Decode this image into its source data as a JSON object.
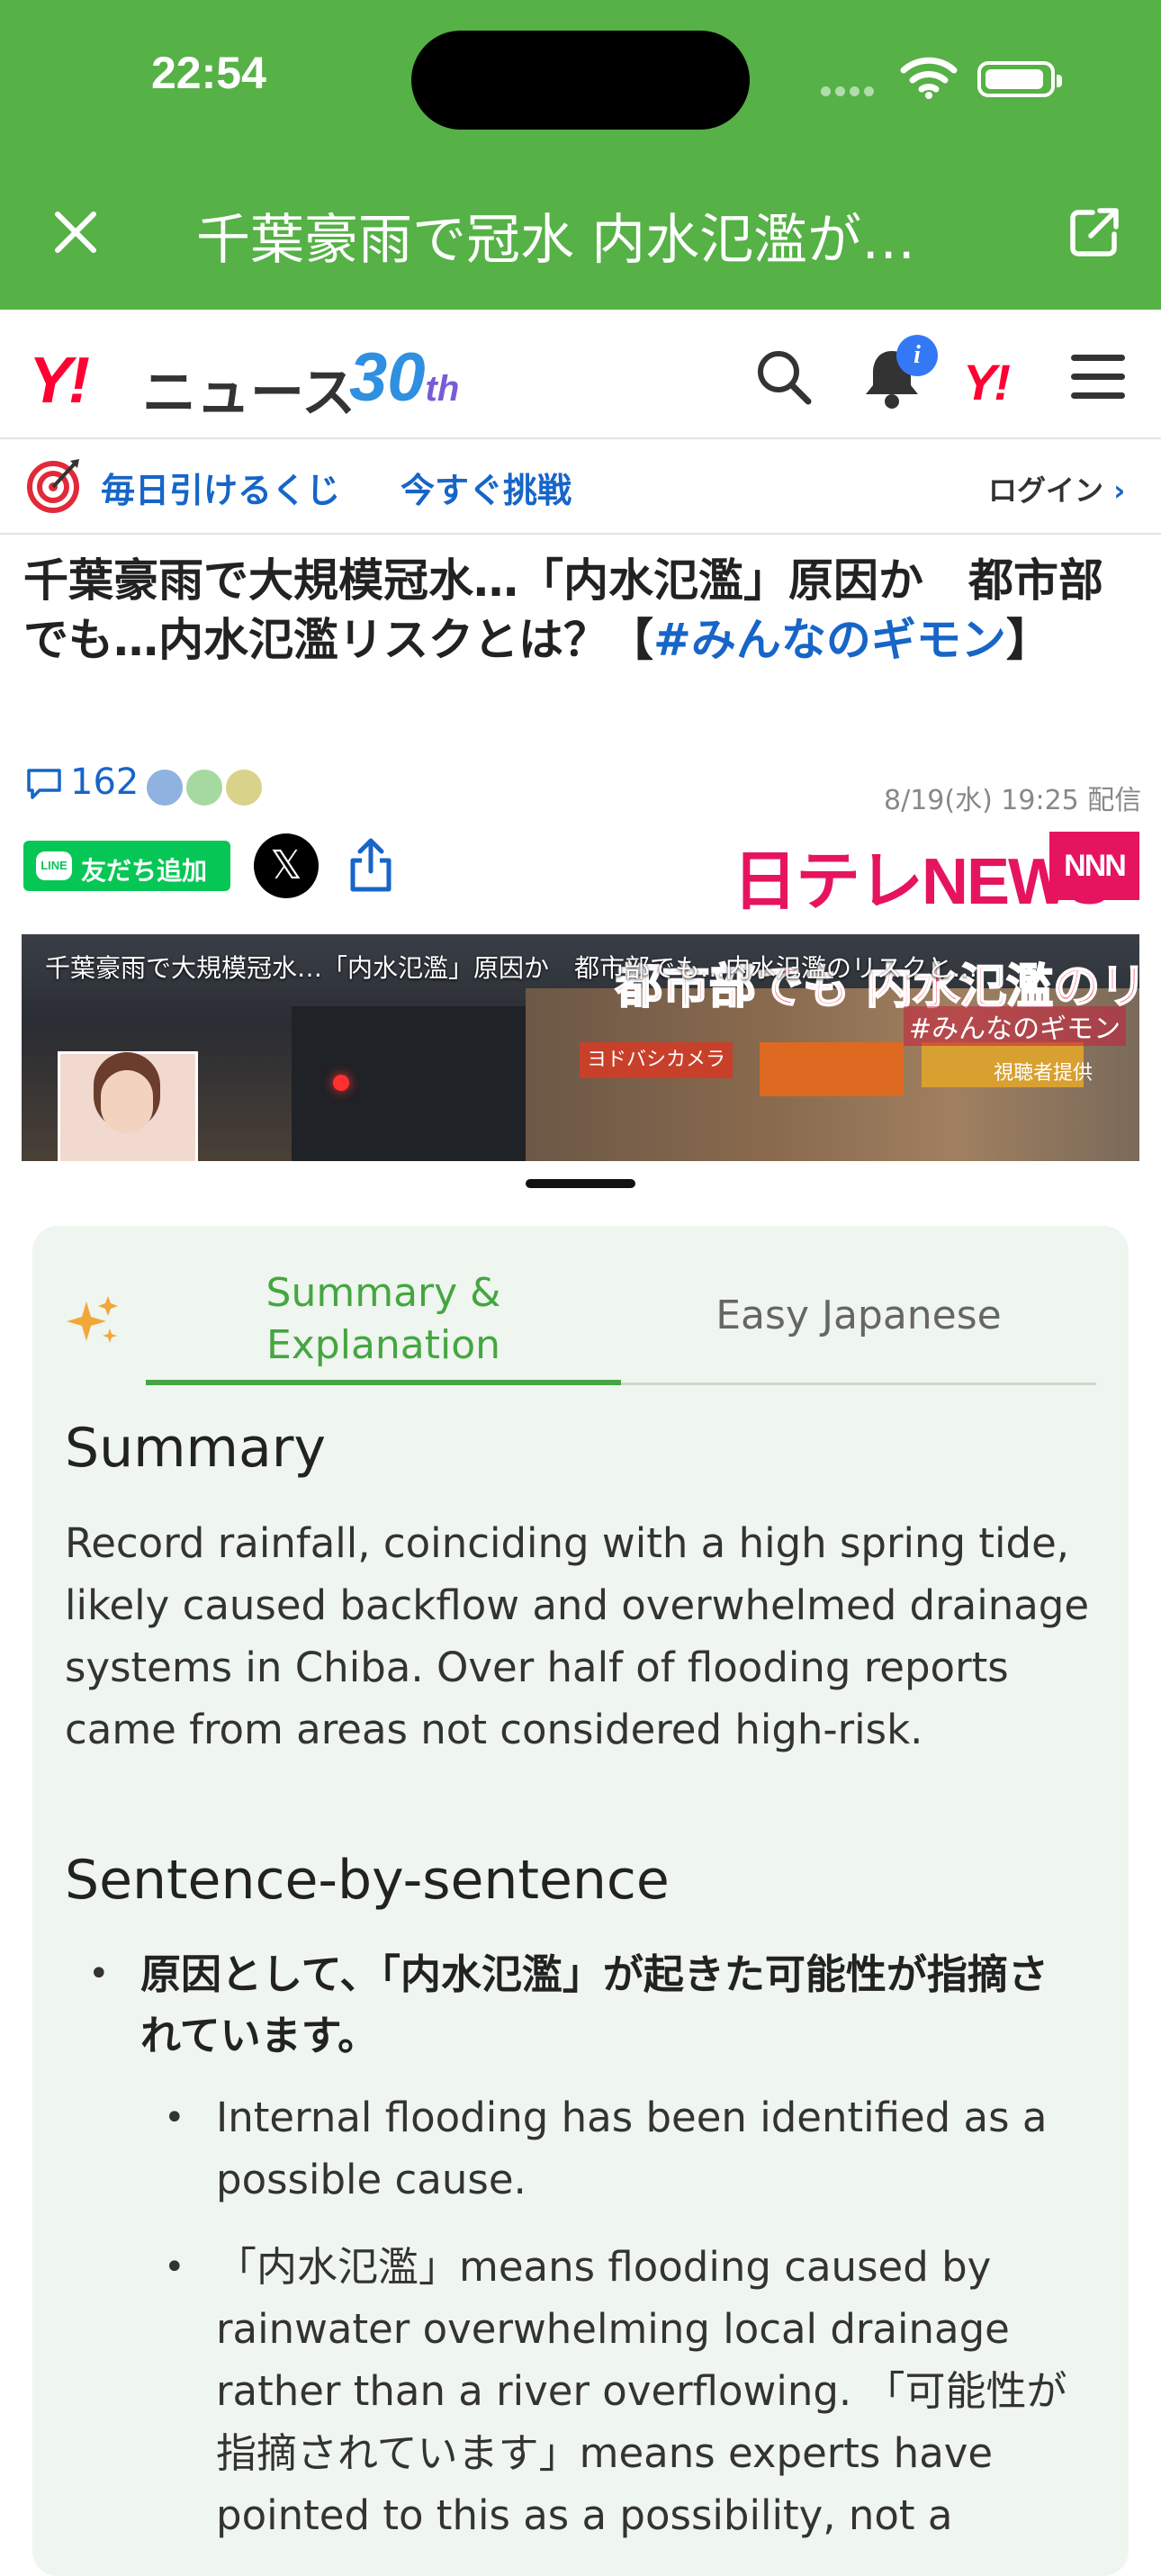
{
  "status_bar": {
    "time": "22:54"
  },
  "app_bar": {
    "title": "千葉豪雨で冠水 内水氾濫が…",
    "color": "#56b146"
  },
  "yahoo_header": {
    "logo": "Y!",
    "service": "ニュース",
    "anniversary": "30",
    "anniversary_suffix": "th",
    "notification_badge": "i",
    "small_logo": "Y!"
  },
  "lottery_bar": {
    "text": "毎日引けるくじ",
    "cta": "今すぐ挑戦",
    "login": "ログイン"
  },
  "article": {
    "headline_main": "千葉豪雨で大規模冠水…「内水氾濫」原因か　都市部でも…内水氾濫リスクとは？【",
    "headline_hashtag": "#みんなのギモン",
    "headline_end": "】",
    "comment_count": "162",
    "published": "8/19(水) 19:25 配信",
    "line_button": "友だち追加",
    "line_icon": "LINE",
    "x_button": "𝕏",
    "publisher_logo": "日テレNEWS",
    "publisher_badge": "NNN"
  },
  "video": {
    "title": "千葉豪雨で大規模冠水…「内水氾濫」原因か　都市部でも…内水氾濫のリスクと…",
    "overlay_main": "都市部でも 内水氾濫のリスク",
    "overlay_tag": "#みんなのギモン",
    "shop_sign": "ヨドバシカメラ",
    "credit": "視聴者提供"
  },
  "panel": {
    "tabs": [
      {
        "label": "Summary & Explanation",
        "active": true
      },
      {
        "label": "Easy Japanese",
        "active": false
      }
    ],
    "summary_heading": "Summary",
    "summary_text": "Record rainfall, coinciding with a high spring tide, likely caused backflow and overwhelmed drainage systems in Chiba. Over half of flooding reports came from areas not considered high-risk.",
    "sbs_heading": "Sentence-by-sentence",
    "sentences": [
      {
        "jp": "原因として、「内水氾濫」が起きた可能性が指摘されています。",
        "notes": [
          "Internal flooding has been identified as a possible cause.",
          "「内水氾濫」means flooding caused by rainwater overwhelming local drainage rather than a river overflowing. 「可能性が指摘されています」means experts have pointed to this as a possibility, not a"
        ]
      }
    ],
    "accent_color": "#45a641"
  }
}
